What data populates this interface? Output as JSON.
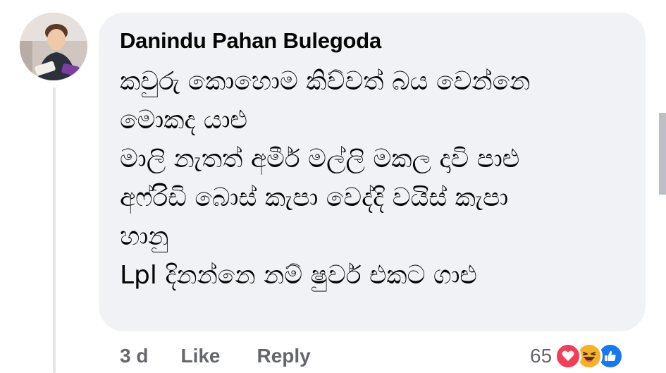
{
  "comment": {
    "author": "Danindu Pahan Bulegoda",
    "lines": [
      "කවුරු කොහොම කිව්වත් බය වෙන්නෙ",
      "මොකද යාළු",
      "මාලි නැතත් අමීර් මල්ලි මකල දාවි පාළු",
      "අෆ්රිඩි බොස් කැපා වෙද්දි වයිස් කැපා",
      "හානු",
      "Lpl දිනන්නෙ නම් ෂුවර් එකට ගාළු"
    ],
    "timestamp": "3 d",
    "like_label": "Like",
    "reply_label": "Reply",
    "reaction_count": "65",
    "reactions": [
      "love-reaction-icon",
      "haha-reaction-icon",
      "like-reaction-icon"
    ]
  },
  "colors": {
    "bubble": "#f0f2f5",
    "secondary_text": "#65676b",
    "love": "#f33e58",
    "haha": "#f7b125",
    "like": "#1877f2"
  }
}
